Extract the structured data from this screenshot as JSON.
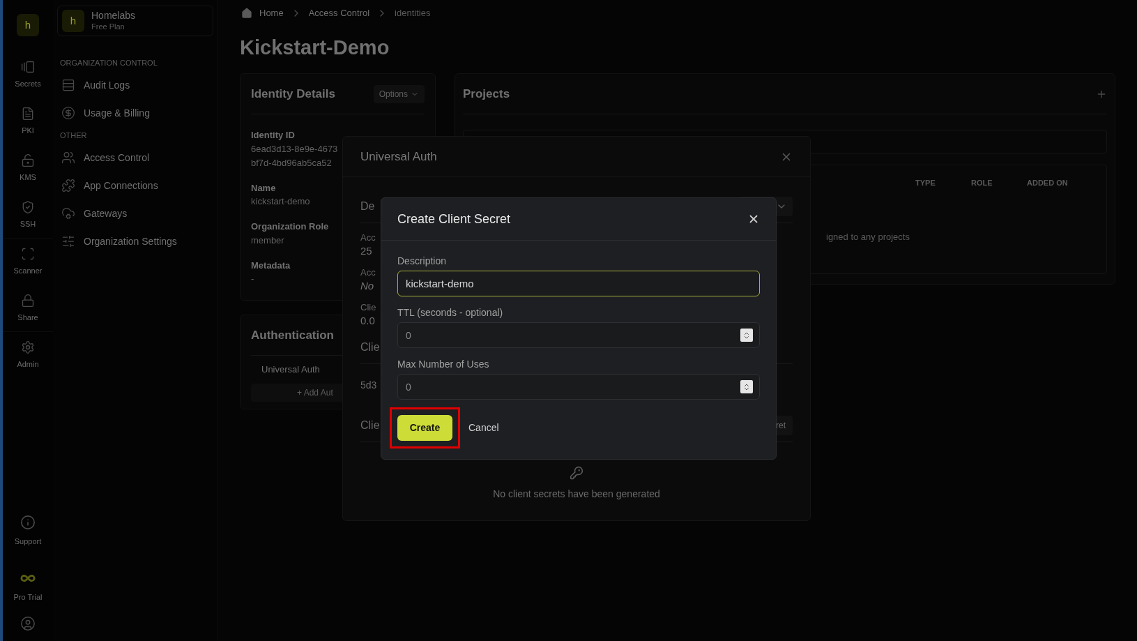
{
  "rail": {
    "logo": "h",
    "items": [
      {
        "label": "Secrets"
      },
      {
        "label": "PKI"
      },
      {
        "label": "KMS"
      },
      {
        "label": "SSH"
      },
      {
        "label": "Scanner"
      },
      {
        "label": "Share"
      },
      {
        "label": "Admin"
      }
    ],
    "bottom": [
      {
        "label": "Support"
      },
      {
        "label": "Pro Trial"
      }
    ]
  },
  "org": {
    "logo": "h",
    "name": "Homelabs",
    "plan": "Free Plan"
  },
  "sidebar": {
    "sections": [
      {
        "title": "ORGANIZATION CONTROL",
        "items": [
          {
            "label": "Audit Logs"
          },
          {
            "label": "Usage & Billing"
          }
        ]
      },
      {
        "title": "OTHER",
        "items": [
          {
            "label": "Access Control"
          },
          {
            "label": "App Connections"
          },
          {
            "label": "Gateways"
          },
          {
            "label": "Organization Settings"
          }
        ]
      }
    ]
  },
  "breadcrumb": [
    "Home",
    "Access Control",
    "identities"
  ],
  "page_title": "Kickstart-Demo",
  "identity_details": {
    "title": "Identity Details",
    "options_button": "Options",
    "fields": [
      {
        "label": "Identity ID",
        "value_lines": [
          "6ead3d13-8e9e-4673",
          "bf7d-4bd96ab5ca52"
        ]
      },
      {
        "label": "Name",
        "value_lines": [
          "kickstart-demo"
        ]
      },
      {
        "label": "Organization Role",
        "value_lines": [
          "member"
        ]
      },
      {
        "label": "Metadata",
        "value_lines": [
          "-"
        ]
      }
    ]
  },
  "authentication": {
    "title": "Authentication",
    "methods": [
      "Universal Auth"
    ],
    "add_button": "+ Add Aut"
  },
  "projects": {
    "title": "Projects",
    "columns": [
      "TYPE",
      "ROLE",
      "ADDED ON"
    ],
    "empty_text": "igned to any projects"
  },
  "universal_auth_modal": {
    "title": "Universal Auth",
    "rows": [
      {
        "kind": "section",
        "text": "De",
        "has_menu": true
      },
      {
        "kind": "field",
        "label": "Acc",
        "value": "25",
        "italic": false
      },
      {
        "kind": "field",
        "label": "Acc",
        "value": "No",
        "italic": true
      },
      {
        "kind": "field",
        "label": "Clie",
        "value": "0.0",
        "italic": false
      },
      {
        "kind": "section",
        "text": "Clie",
        "has_menu": false
      },
      {
        "kind": "text",
        "text": "5d3"
      },
      {
        "kind": "section",
        "text": "Clie",
        "has_menu": false,
        "button": "ret"
      }
    ],
    "empty_text": "No client secrets have been generated"
  },
  "create_client_secret_modal": {
    "title": "Create Client Secret",
    "fields": [
      {
        "kind": "text",
        "label": "Description",
        "value": "kickstart-demo",
        "focused": true
      },
      {
        "kind": "number",
        "label": "TTL (seconds - optional)",
        "placeholder": "0",
        "focused": false
      },
      {
        "kind": "number",
        "label": "Max Number of Uses",
        "placeholder": "0",
        "focused": false
      }
    ],
    "create_button": {
      "label": "Create",
      "highlighted": true
    },
    "cancel_button": "Cancel"
  }
}
